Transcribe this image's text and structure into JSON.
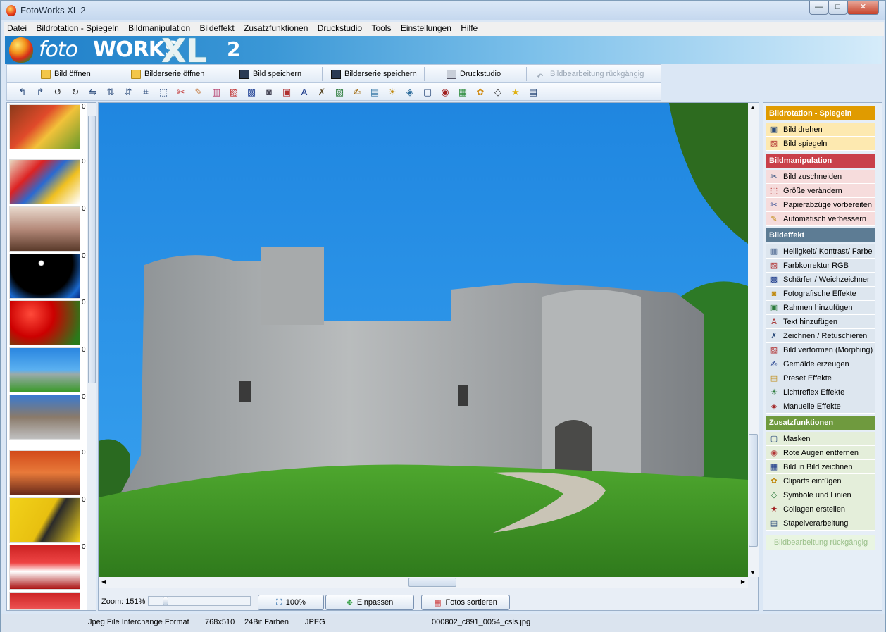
{
  "window": {
    "title": "FotoWorks XL 2",
    "min": "—",
    "max": "□",
    "close": "✕"
  },
  "menu": [
    "Datei",
    "Bildrotation - Spiegeln",
    "Bildmanipulation",
    "Bildeffekt",
    "Zusatzfunktionen",
    "Druckstudio",
    "Tools",
    "Einstellungen",
    "Hilfe"
  ],
  "banner": {
    "foto": "foto",
    "works": "WORKS",
    "xl": "XL",
    "two": "2"
  },
  "toolbar": {
    "open": "Bild öffnen",
    "open_series": "Bilderserie öffnen",
    "save": "Bild speichern",
    "save_series": "Bilderserie speichern",
    "print": "Druckstudio",
    "undo": "Bildbearbeitung rückgängig"
  },
  "icons": [
    "rotate-left-icon",
    "rotate-right-icon",
    "rotate-ccw-icon",
    "rotate-cw-icon",
    "mirror-icon",
    "flip-icon",
    "flip-vertical-icon",
    "crop-icon",
    "resize-icon",
    "scissors-icon",
    "wand-icon",
    "levels-icon",
    "rgb-icon",
    "sharpen-icon",
    "camera-icon",
    "frame-icon",
    "text-icon",
    "draw-icon",
    "morph-icon",
    "painting-icon",
    "preset-icon",
    "lensflare-icon",
    "manual-icon",
    "mask-icon",
    "redeye-icon",
    "pip-icon",
    "clipart-icon",
    "symbols-icon",
    "star-icon",
    "batch-icon"
  ],
  "thumb_number": "0",
  "zoom": {
    "label": "Zoom: 151%",
    "btn100": "100%",
    "fit": "Einpassen",
    "sort": "Fotos sortieren",
    "level": 0.15
  },
  "panel": {
    "rotation": {
      "title": "Bildrotation - Spiegeln",
      "color": "#e09b00",
      "items": [
        "Bild drehen",
        "Bild spiegeln"
      ]
    },
    "manipulation": {
      "title": "Bildmanipulation",
      "color": "#c9404a",
      "items": [
        "Bild zuschneiden",
        "Größe verändern",
        "Papierabzüge vorbereiten",
        "Automatisch verbessern"
      ]
    },
    "effect": {
      "title": "Bildeffekt",
      "color": "#5d7c94",
      "items": [
        "Helligkeit/ Kontrast/ Farbe",
        "Farbkorrektur RGB",
        "Schärfer / Weichzeichner",
        "Fotografische Effekte",
        "Rahmen hinzufügen",
        "Text hinzufügen",
        "Zeichnen / Retuschieren",
        "Bild verformen (Morphing)",
        "Gemälde erzeugen",
        "Preset Effekte",
        "Lichtreflex Effekte",
        "Manuelle Effekte"
      ]
    },
    "extras": {
      "title": "Zusatzfunktionen",
      "color": "#6f9a3e",
      "items": [
        "Masken",
        "Rote Augen entfernen",
        "Bild in Bild zeichnen",
        "Cliparts einfügen",
        "Symbole und Linien",
        "Collagen erstellen",
        "Stapelverarbeitung"
      ]
    },
    "undo": "Bildbearbeitung rückgängig"
  },
  "status": {
    "format": "Jpeg File Interchange Format",
    "size": "768x510",
    "depth": "24Bit Farben",
    "type": "JPEG",
    "file": "000802_c891_0054_csls.jpg"
  }
}
